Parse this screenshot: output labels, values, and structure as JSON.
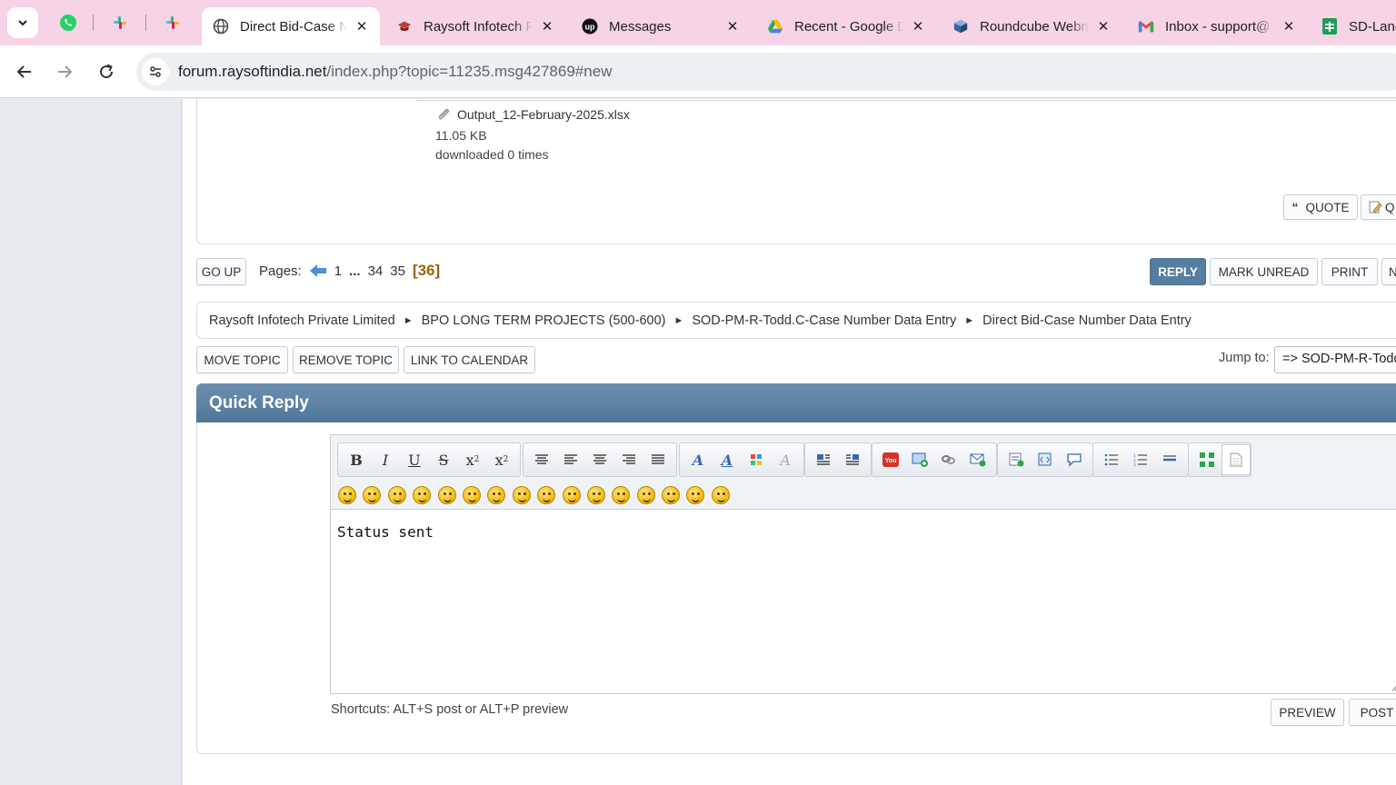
{
  "browser": {
    "tabs": [
      {
        "title": "Direct Bid-Case Number Data Entry",
        "icon": "globe-icon",
        "active": true
      },
      {
        "title": "Raysoft Infotech Private Limited",
        "icon": "raysoft-icon",
        "active": false
      },
      {
        "title": "Messages",
        "icon": "upwork-icon",
        "active": false
      },
      {
        "title": "Recent - Google Drive",
        "icon": "google-drive-icon",
        "active": false
      },
      {
        "title": "Roundcube Webmail",
        "icon": "roundcube-icon",
        "active": false
      },
      {
        "title": "Inbox - support@",
        "icon": "gmail-icon",
        "active": false
      },
      {
        "title": "SD-Lane",
        "icon": "sheets-icon",
        "active": false
      }
    ],
    "pinned_icons": [
      "whatsapp-icon",
      "slack-icon",
      "slack-icon"
    ],
    "url_host": "forum.raysoftindia.net",
    "url_path": "/index.php?topic=11235.msg427869#new"
  },
  "attachment": {
    "filename": "Output_12-February-2025.xlsx",
    "size": "11.05 KB",
    "downloads": "downloaded 0 times"
  },
  "post_buttons": {
    "quote": "QUOTE",
    "quick_edit": "Q"
  },
  "pagination": {
    "go_up": "GO UP",
    "label": "Pages:",
    "first": "1",
    "ellipsis": "...",
    "pages": [
      "34",
      "35"
    ],
    "current": "[36]"
  },
  "topic_buttons": {
    "reply": "REPLY",
    "mark_unread": "MARK UNREAD",
    "print": "PRINT",
    "next": "N"
  },
  "breadcrumb": [
    "Raysoft Infotech Private Limited",
    "BPO LONG TERM PROJECTS (500-600)",
    "SOD-PM-R-Todd.C-Case Number Data Entry",
    "Direct Bid-Case Number Data Entry"
  ],
  "mod_buttons": {
    "move": "MOVE TOPIC",
    "remove": "REMOVE TOPIC",
    "calendar": "LINK TO CALENDAR"
  },
  "jump": {
    "label": "Jump to:",
    "selected": "=> SOD-PM-R-Todd.C-Case Number Data Entry"
  },
  "quick_reply": {
    "title": "Quick Reply",
    "text": "Status sent",
    "shortcuts": "Shortcuts: ALT+S post or ALT+P preview",
    "preview": "PREVIEW",
    "post": "POST"
  },
  "colors": {
    "header_blue": "#557ea0",
    "tab_strip": "#f6d3e5",
    "current_page": "#a36008"
  }
}
